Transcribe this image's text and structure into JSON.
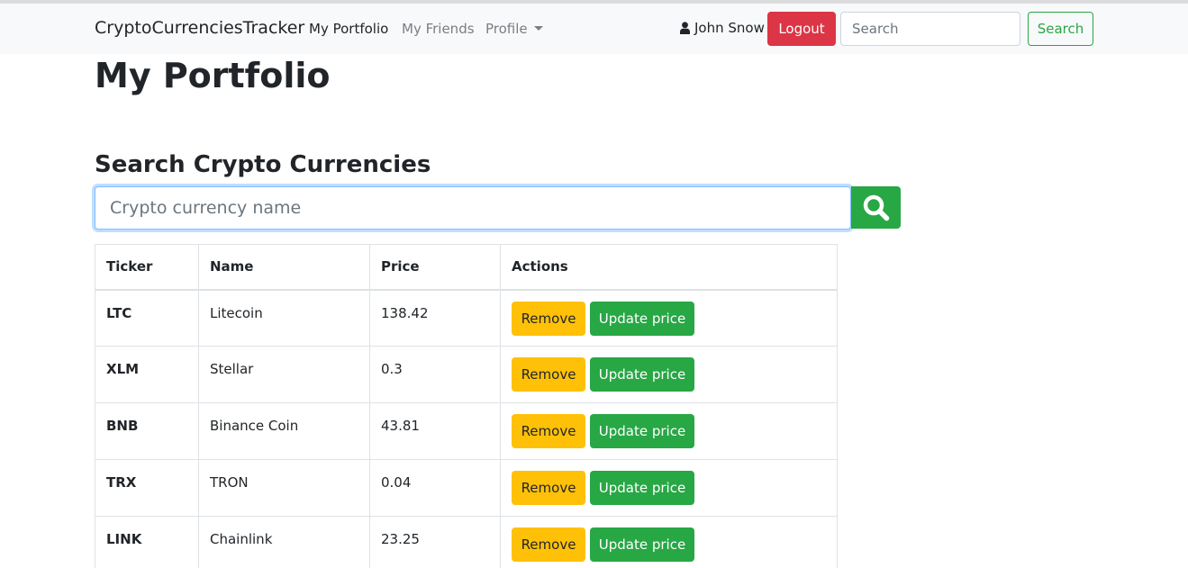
{
  "colors": {
    "danger": "#dc3545",
    "success": "#28a745",
    "warning": "#ffc107",
    "navbar_bg": "#f8f9fa",
    "text": "#212529",
    "muted": "#7a7f85"
  },
  "navbar": {
    "brand": "CryptoCurrenciesTracker",
    "links": [
      {
        "label": "My Portfolio",
        "active": true
      },
      {
        "label": "My Friends",
        "active": false
      },
      {
        "label": "Profile",
        "active": false,
        "dropdown": true
      }
    ],
    "user_icon": "user-icon",
    "user_name": "John Snow",
    "logout_label": "Logout",
    "search_placeholder": "Search",
    "search_button": "Search"
  },
  "main": {
    "title": "My Portfolio",
    "search_section": {
      "title": "Search Crypto Currencies",
      "placeholder": "Crypto currency name",
      "button_icon": "search-icon"
    },
    "table": {
      "headers": [
        "Ticker",
        "Name",
        "Price",
        "Actions"
      ],
      "rows": [
        {
          "ticker": "LTC",
          "name": "Litecoin",
          "price": "138.42"
        },
        {
          "ticker": "XLM",
          "name": "Stellar",
          "price": "0.3"
        },
        {
          "ticker": "BNB",
          "name": "Binance Coin",
          "price": "43.81"
        },
        {
          "ticker": "TRX",
          "name": "TRON",
          "price": "0.04"
        },
        {
          "ticker": "LINK",
          "name": "Chainlink",
          "price": "23.25"
        }
      ],
      "remove_label": "Remove",
      "update_label": "Update price"
    }
  }
}
